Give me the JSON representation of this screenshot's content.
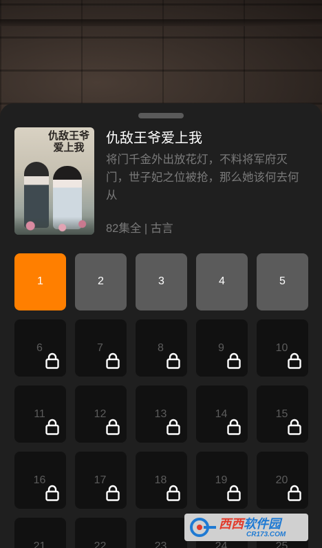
{
  "drama": {
    "poster_title": "仇敌王爷爱上我",
    "title": "仇敌王爷爱上我",
    "description": "将门千金外出放花灯，不料将军府灭门，世子妃之位被抢，那么她该何去何从",
    "meta": "82集全 | 古言"
  },
  "episodes": [
    {
      "label": "1",
      "state": "active"
    },
    {
      "label": "2",
      "state": "free"
    },
    {
      "label": "3",
      "state": "free"
    },
    {
      "label": "4",
      "state": "free"
    },
    {
      "label": "5",
      "state": "free"
    },
    {
      "label": "6",
      "state": "locked"
    },
    {
      "label": "7",
      "state": "locked"
    },
    {
      "label": "8",
      "state": "locked"
    },
    {
      "label": "9",
      "state": "locked"
    },
    {
      "label": "10",
      "state": "locked"
    },
    {
      "label": "11",
      "state": "locked"
    },
    {
      "label": "12",
      "state": "locked"
    },
    {
      "label": "13",
      "state": "locked"
    },
    {
      "label": "14",
      "state": "locked"
    },
    {
      "label": "15",
      "state": "locked"
    },
    {
      "label": "16",
      "state": "locked"
    },
    {
      "label": "17",
      "state": "locked"
    },
    {
      "label": "18",
      "state": "locked"
    },
    {
      "label": "19",
      "state": "locked"
    },
    {
      "label": "20",
      "state": "locked"
    },
    {
      "label": "21",
      "state": "locked"
    },
    {
      "label": "22",
      "state": "locked"
    },
    {
      "label": "23",
      "state": "locked"
    },
    {
      "label": "24",
      "state": "locked"
    },
    {
      "label": "25",
      "state": "locked"
    }
  ],
  "colors": {
    "active": "#ff7f00",
    "free": "#5b5b5b",
    "locked": "#111111",
    "sheet": "#1f1f1f"
  },
  "icons": {
    "lock": "lock-icon"
  },
  "watermark": {
    "main_prefix": "西西",
    "main_suffix": "软件园",
    "url": "CR173.COM"
  }
}
